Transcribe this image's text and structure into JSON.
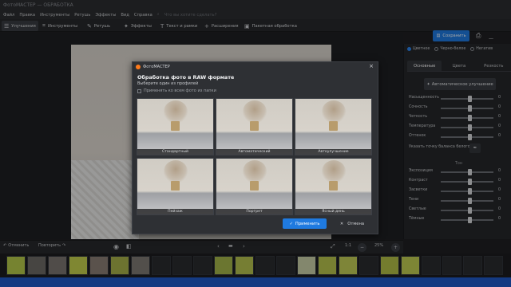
{
  "window": {
    "title": "ФотоМАСТЕР — ОБРАБОТКА"
  },
  "menu": {
    "items": [
      "Файл",
      "Правка",
      "Инструменты",
      "Ретушь",
      "Эффекты",
      "Вид",
      "Справка"
    ],
    "search": "Что вы хотите сделать?"
  },
  "toolbar": {
    "tabs": [
      {
        "label": "Улучшения",
        "icon": "sliders-icon"
      },
      {
        "label": "Инструменты",
        "icon": "crop-icon"
      },
      {
        "label": "Ретушь",
        "icon": "brush-icon"
      },
      {
        "label": "Эффекты",
        "icon": "wand-icon"
      },
      {
        "label": "Текст и рамки",
        "icon": "text-icon"
      },
      {
        "label": "Расширения",
        "icon": "plus-icon"
      },
      {
        "label": "Пакетная обработка",
        "icon": "stack-icon"
      }
    ],
    "save_label": "Сохранить"
  },
  "panel": {
    "radios": [
      {
        "label": "Цветное",
        "checked": true
      },
      {
        "label": "Черно-белое",
        "checked": false
      },
      {
        "label": "Негатив",
        "checked": false
      }
    ],
    "tabs": [
      "Основные",
      "Цвета",
      "Резкость"
    ],
    "auto_button": "Автоматическое улучшение",
    "sliders_top": [
      {
        "label": "Насыщенность",
        "value": "0",
        "pos": 0.55
      },
      {
        "label": "Сочность",
        "value": "0",
        "pos": 0.55
      },
      {
        "label": "Четкость",
        "value": "0",
        "pos": 0.55
      },
      {
        "label": "Температура",
        "value": "0",
        "pos": 0.55
      },
      {
        "label": "Оттенок",
        "value": "0",
        "pos": 0.55
      }
    ],
    "white_balance_label": "Указать точку баланса белого",
    "tone_label": "Тон",
    "sliders_tone": [
      {
        "label": "Экспозиция",
        "value": "0",
        "pos": 0.55
      },
      {
        "label": "Контраст",
        "value": "0",
        "pos": 0.55
      },
      {
        "label": "Засветки",
        "value": "0",
        "pos": 0.55
      },
      {
        "label": "Тени",
        "value": "0",
        "pos": 0.55
      },
      {
        "label": "Светлые",
        "value": "0",
        "pos": 0.55
      },
      {
        "label": "Тёмные",
        "value": "0",
        "pos": 0.55
      }
    ]
  },
  "bottombar": {
    "undo": "Отменить",
    "redo": "Повторить",
    "ratio": "1:1",
    "zoom": "25%"
  },
  "dialog": {
    "app": "ФотоМАСТЕР",
    "title": "Обработка фото в RAW формате",
    "subtitle": "Выберите один из профилей",
    "checkbox": "Применять ко всем фото из папки",
    "profiles": [
      "Стандартный",
      "Автоматический",
      "Автоулучшение",
      "Пейзаж",
      "Портрет",
      "Ясный день"
    ],
    "apply": "Применить",
    "cancel": "Отмена"
  }
}
